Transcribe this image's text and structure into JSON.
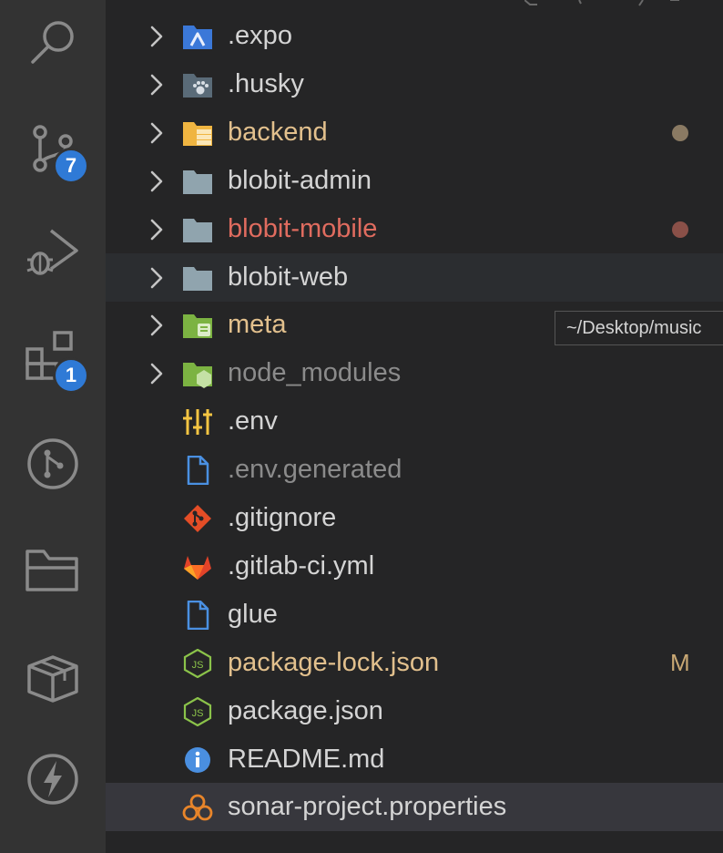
{
  "activity_bar": {
    "items": [
      {
        "name": "search",
        "badge": null
      },
      {
        "name": "source-control",
        "badge": "7"
      },
      {
        "name": "run-debug",
        "badge": null
      },
      {
        "name": "extensions",
        "badge": "1"
      },
      {
        "name": "git-graph",
        "badge": null
      },
      {
        "name": "project-manager",
        "badge": null
      },
      {
        "name": "packages",
        "badge": null
      },
      {
        "name": "thunder-client",
        "badge": null
      }
    ]
  },
  "explorer": {
    "tooltip": "~/Desktop/music",
    "items": [
      {
        "label": ".expo",
        "type": "folder",
        "icon": "expo-folder-icon",
        "color": "#d4d4d4"
      },
      {
        "label": ".husky",
        "type": "folder",
        "icon": "husky-folder-icon",
        "color": "#d4d4d4"
      },
      {
        "label": "backend",
        "type": "folder",
        "icon": "server-folder-icon",
        "color": "#e2c08d",
        "status_dot": "#8a7a63"
      },
      {
        "label": "blobit-admin",
        "type": "folder",
        "icon": "folder-icon",
        "color": "#d4d4d4"
      },
      {
        "label": "blobit-mobile",
        "type": "folder",
        "icon": "folder-icon",
        "color": "#e06c5f",
        "status_dot": "#8a5048"
      },
      {
        "label": "blobit-web",
        "type": "folder",
        "icon": "folder-icon",
        "color": "#d4d4d4"
      },
      {
        "label": "meta",
        "type": "folder",
        "icon": "meta-folder-icon",
        "color": "#e2c08d"
      },
      {
        "label": "node_modules",
        "type": "folder",
        "icon": "node-folder-icon",
        "color": "#8b8b8b"
      },
      {
        "label": ".env",
        "type": "file",
        "icon": "env-settings-icon",
        "color": "#d4d4d4"
      },
      {
        "label": ".env.generated",
        "type": "file",
        "icon": "file-icon",
        "color": "#8b8b8b"
      },
      {
        "label": ".gitignore",
        "type": "file",
        "icon": "git-icon",
        "color": "#d4d4d4"
      },
      {
        "label": ".gitlab-ci.yml",
        "type": "file",
        "icon": "gitlab-icon",
        "color": "#d4d4d4"
      },
      {
        "label": "glue",
        "type": "file",
        "icon": "file-icon",
        "color": "#d4d4d4"
      },
      {
        "label": "package-lock.json",
        "type": "file",
        "icon": "nodejs-icon",
        "color": "#e2c08d",
        "badge": "M"
      },
      {
        "label": "package.json",
        "type": "file",
        "icon": "nodejs-icon",
        "color": "#d4d4d4"
      },
      {
        "label": "README.md",
        "type": "file",
        "icon": "info-icon",
        "color": "#d4d4d4"
      },
      {
        "label": "sonar-project.properties",
        "type": "file",
        "icon": "sonar-icon",
        "color": "#d4d4d4"
      }
    ]
  }
}
